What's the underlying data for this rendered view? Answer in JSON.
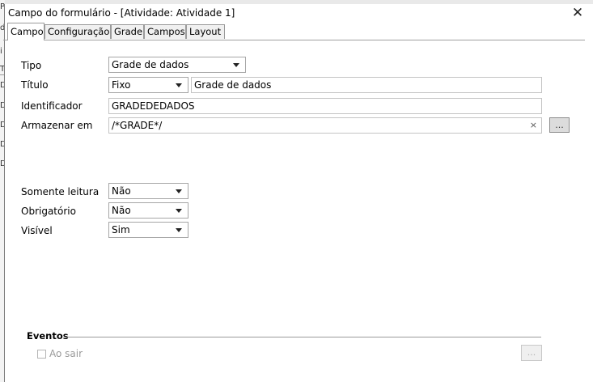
{
  "dialog": {
    "title": "Campo do formulário - [Atividade: Atividade 1]",
    "close_symbol": "✕"
  },
  "tabs": [
    {
      "label": "Campo",
      "active": true
    },
    {
      "label": "Configuração",
      "active": false
    },
    {
      "label": "Grade",
      "active": false
    },
    {
      "label": "Campos",
      "active": false
    },
    {
      "label": "Layout",
      "active": false
    }
  ],
  "form": {
    "tipo": {
      "label": "Tipo",
      "value": "Grade de dados"
    },
    "titulo": {
      "label": "Título",
      "mode": "Fixo",
      "value": "Grade de dados"
    },
    "identificador": {
      "label": "Identificador",
      "value": "GRADEDEDADOS"
    },
    "armazenar": {
      "label": "Armazenar em",
      "value": "/*GRADE*/",
      "clear": "×",
      "button": "..."
    },
    "somente_leitura": {
      "label": "Somente leitura",
      "value": "Não"
    },
    "obrigatorio": {
      "label": "Obrigatório",
      "value": "Não"
    },
    "visivel": {
      "label": "Visível",
      "value": "Sim"
    }
  },
  "eventos": {
    "title": "Eventos",
    "ao_sair_label": "Ao sair",
    "ao_sair_checked": false,
    "button": "..."
  },
  "background_app": {
    "fragments": [
      "P",
      "d",
      "i",
      "T",
      "D",
      "D",
      "D",
      "D",
      "D"
    ]
  }
}
